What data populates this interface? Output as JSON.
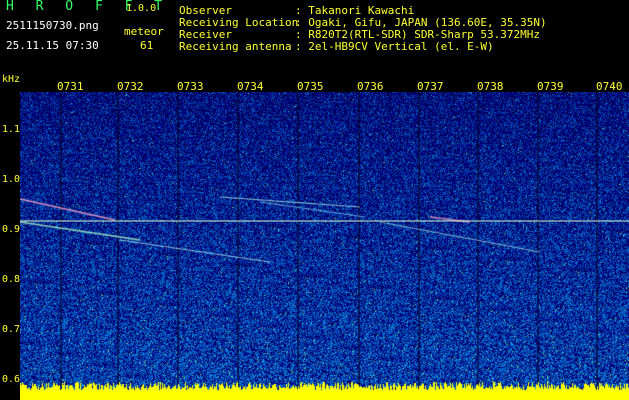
{
  "header": {
    "brand": "H R O F F T",
    "version": "1.0.0",
    "filename": "2511150730.png",
    "datetime": "25.11.15 07:30",
    "meteor_label": "meteor",
    "meteor_count": "61"
  },
  "info": {
    "rows": [
      {
        "label": "Observer",
        "value": ": Takanori Kawachi"
      },
      {
        "label": "Receiving Location",
        "value": ": Ogaki, Gifu, JAPAN (136.60E, 35.35N)"
      },
      {
        "label": "Receiver",
        "value": ": R820T2(RTL-SDR) SDR-Sharp 53.372MHz"
      },
      {
        "label": "Receiving antenna",
        "value": ": 2el-HB9CV Vertical (el. E-W)"
      }
    ]
  },
  "axis": {
    "unit": "kHz",
    "y_ticks": [
      "1.1",
      "1.0",
      "0.9",
      "0.8",
      "0.7",
      "0.6"
    ],
    "time_ticks": [
      "0731",
      "0732",
      "0733",
      "0734",
      "0735",
      "0736",
      "0737",
      "0738",
      "0739",
      "0740"
    ]
  },
  "colors": {
    "background": "#000000",
    "label": "#ffff33",
    "brand": "#33ff66",
    "spectrogram_low": "#00008b",
    "spectrogram_mid": "#3aa0ff",
    "spectrogram_high": "#ffff00"
  }
}
